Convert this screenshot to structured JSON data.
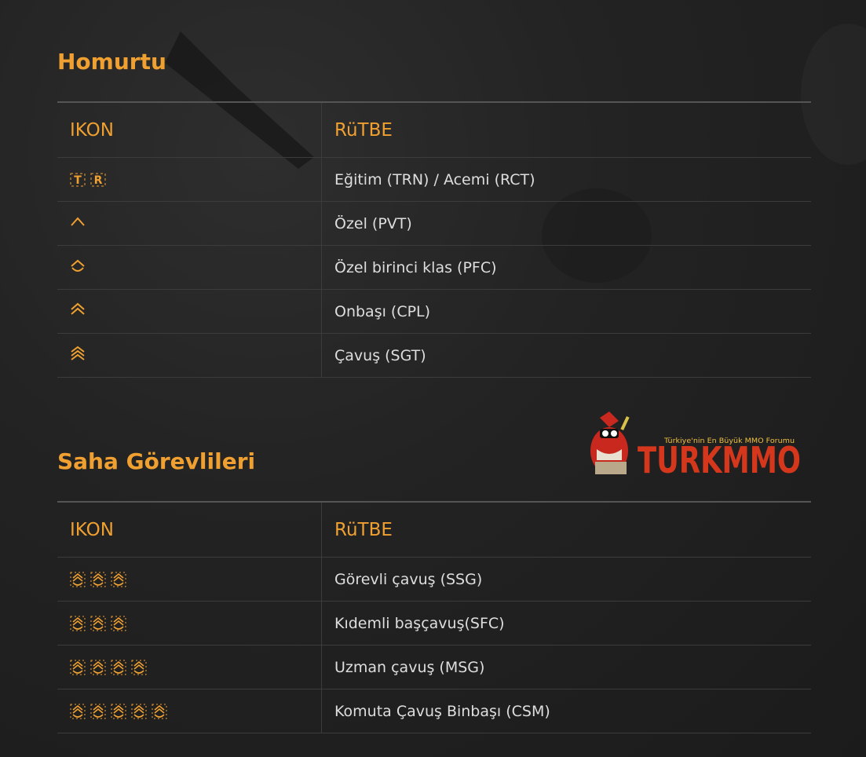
{
  "colors": {
    "accent": "#f0a030",
    "text": "#dedede",
    "border": "#3c3c3c"
  },
  "section1": {
    "title": "Homurtu",
    "header": {
      "icon_col": "IKON",
      "rank_col": "RüTBE"
    },
    "rows": [
      {
        "icon": "trn-rct-insignia-icon",
        "rank": "Eğitim (TRN) / Acemi (RCT)"
      },
      {
        "icon": "pvt-chevron-icon",
        "rank": "Özel (PVT)"
      },
      {
        "icon": "pfc-chevron-icon",
        "rank": "Özel birinci klas (PFC)"
      },
      {
        "icon": "cpl-chevron-icon",
        "rank": "Onbaşı (CPL)"
      },
      {
        "icon": "sgt-chevron-icon",
        "rank": "Çavuş (SGT)"
      }
    ]
  },
  "logo": {
    "tagline": "Türkiye'nin En Büyük MMO Forumu",
    "word": "TURKMMO"
  },
  "section2": {
    "title": "Saha Görevlileri",
    "header": {
      "icon_col": "IKON",
      "rank_col": "RüTBE"
    },
    "rows": [
      {
        "icon": "ssg-insignia-icon",
        "rank": "Görevli çavuş (SSG)"
      },
      {
        "icon": "sfc-insignia-icon",
        "rank": "Kıdemli başçavuş(SFC)"
      },
      {
        "icon": "msg-insignia-icon",
        "rank": "Uzman çavuş (MSG)"
      },
      {
        "icon": "csm-insignia-icon",
        "rank": "Komuta Çavuş Binbaşı (CSM)"
      }
    ]
  }
}
